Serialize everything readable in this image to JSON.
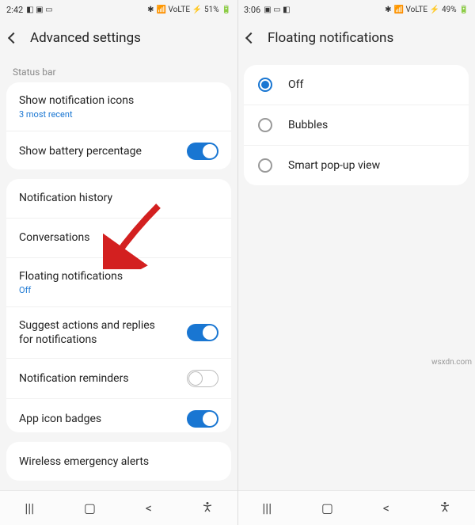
{
  "left": {
    "status": {
      "time": "2:42",
      "battery": "51%"
    },
    "header": {
      "title": "Advanced settings"
    },
    "section_label": "Status bar",
    "rows": {
      "notif_icons": {
        "title": "Show notification icons",
        "sub": "3 most recent"
      },
      "battery_pct": {
        "title": "Show battery percentage"
      },
      "history": {
        "title": "Notification history"
      },
      "conversations": {
        "title": "Conversations"
      },
      "floating": {
        "title": "Floating notifications",
        "sub": "Off"
      },
      "suggest": {
        "title": "Suggest actions and replies for notifications"
      },
      "reminders": {
        "title": "Notification reminders"
      },
      "badges": {
        "title": "App icon badges"
      },
      "emergency": {
        "title": "Wireless emergency alerts"
      }
    }
  },
  "right": {
    "status": {
      "time": "3:06",
      "battery": "49%"
    },
    "header": {
      "title": "Floating notifications"
    },
    "options": {
      "off": "Off",
      "bubbles": "Bubbles",
      "smart": "Smart pop-up view"
    }
  },
  "watermark": "wsxdn.com"
}
